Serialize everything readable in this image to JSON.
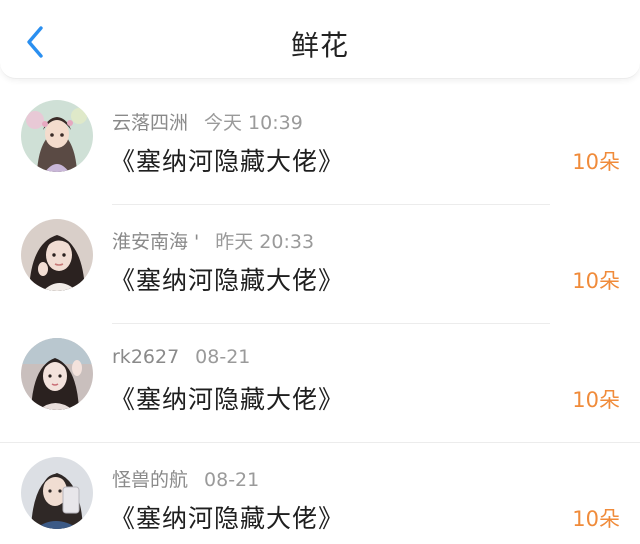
{
  "header": {
    "title": "鲜花",
    "back_icon": "chevron-left-icon",
    "accent_color": "#2a8ff0"
  },
  "records": [
    {
      "user": "云落四洲",
      "time": "今天 10:39",
      "book": "《塞纳河隐藏大佬》",
      "count": "10朵"
    },
    {
      "user": "淮安南海 '",
      "time": "昨天 20:33",
      "book": "《塞纳河隐藏大佬》",
      "count": "10朵"
    },
    {
      "user": "rk2627",
      "time": "08-21",
      "book": "《塞纳河隐藏大佬》",
      "count": "10朵"
    },
    {
      "user": "怪兽的航",
      "time": "08-21",
      "book": "《塞纳河隐藏大佬》",
      "count": "10朵"
    }
  ],
  "colors": {
    "count": "#f08b3a",
    "meta": "#8a8a8a",
    "title": "#222222"
  }
}
